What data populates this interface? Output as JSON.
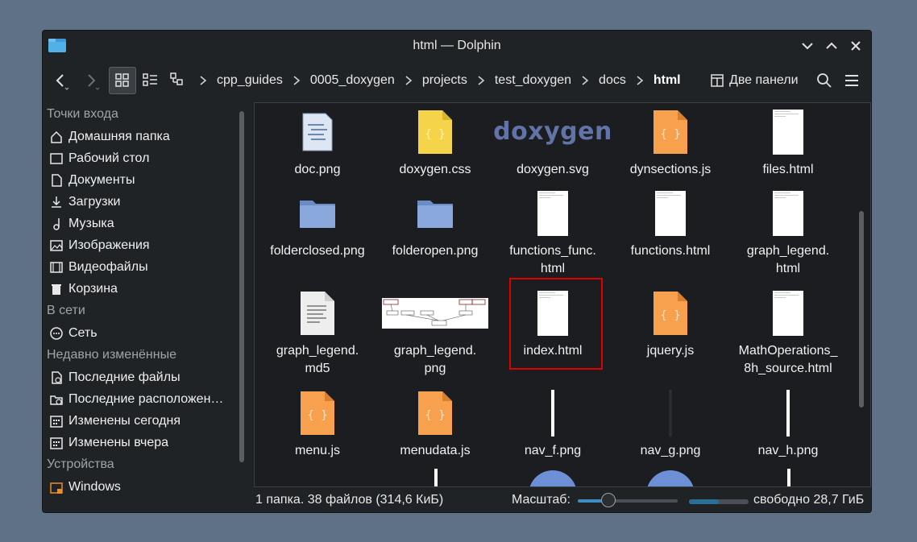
{
  "window": {
    "title": "html — Dolphin"
  },
  "breadcrumb": [
    "cpp_guides",
    "0005_doxygen",
    "projects",
    "test_doxygen",
    "docs",
    "html"
  ],
  "toolbar": {
    "split_label": "Две панели"
  },
  "sidebar": {
    "groups": [
      {
        "label": "Точки входа",
        "items": [
          {
            "label": "Домашняя папка",
            "icon": "home-icon"
          },
          {
            "label": "Рабочий стол",
            "icon": "desktop-icon"
          },
          {
            "label": "Документы",
            "icon": "documents-icon"
          },
          {
            "label": "Загрузки",
            "icon": "downloads-icon"
          },
          {
            "label": "Музыка",
            "icon": "music-icon"
          },
          {
            "label": "Изображения",
            "icon": "pictures-icon"
          },
          {
            "label": "Видеофайлы",
            "icon": "videos-icon"
          },
          {
            "label": "Корзина",
            "icon": "trash-icon"
          }
        ]
      },
      {
        "label": "В сети",
        "items": [
          {
            "label": "Сеть",
            "icon": "network-icon"
          }
        ]
      },
      {
        "label": "Недавно изменённые",
        "items": [
          {
            "label": "Последние файлы",
            "icon": "recent-files-icon"
          },
          {
            "label": "Последние расположен…",
            "icon": "recent-locations-icon"
          },
          {
            "label": "Изменены сегодня",
            "icon": "calendar-icon"
          },
          {
            "label": "Изменены вчера",
            "icon": "calendar-icon"
          }
        ]
      },
      {
        "label": "Устройства",
        "items": [
          {
            "label": "Windows",
            "icon": "drive-icon"
          }
        ]
      }
    ]
  },
  "files": [
    {
      "name": "doc.png",
      "icon": "doc-image"
    },
    {
      "name": "doxygen.css",
      "icon": "css-file"
    },
    {
      "name": "doxygen.svg",
      "icon": "doxygen-logo"
    },
    {
      "name": "dynsections.js",
      "icon": "js-file"
    },
    {
      "name": "files.html",
      "icon": "html-file"
    },
    {
      "name": "folderclosed.png",
      "icon": "folder-image"
    },
    {
      "name": "folderopen.png",
      "icon": "folder-image"
    },
    {
      "name": "functions_func.\nhtml",
      "icon": "html-file"
    },
    {
      "name": "functions.html",
      "icon": "html-file"
    },
    {
      "name": "graph_legend.\nhtml",
      "icon": "html-file"
    },
    {
      "name": "graph_legend.\nmd5",
      "icon": "text-file"
    },
    {
      "name": "graph_legend.\npng",
      "icon": "graph-image"
    },
    {
      "name": "index.html",
      "icon": "html-file",
      "highlighted": true
    },
    {
      "name": "jquery.js",
      "icon": "js-file"
    },
    {
      "name": "MathOperations_\n8h_source.html",
      "icon": "html-file"
    },
    {
      "name": "menu.js",
      "icon": "js-file"
    },
    {
      "name": "menudata.js",
      "icon": "js-file"
    },
    {
      "name": "nav_f.png",
      "icon": "nav-strip"
    },
    {
      "name": "nav_g.png",
      "icon": "nav-strip-dark"
    },
    {
      "name": "nav_h.png",
      "icon": "nav-strip"
    }
  ],
  "doxygen_logo_text": "doxygen",
  "status": {
    "summary": "1 папка. 38 файлов (314,6 КиБ)",
    "zoom_label": "Масштаб:",
    "zoom_level": 0.3,
    "free_space": "свободно 28,7 ГиБ",
    "disk_used_fraction": 0.5
  },
  "colors": {
    "highlight": "#e00000",
    "accent": "#3d8cc4"
  }
}
